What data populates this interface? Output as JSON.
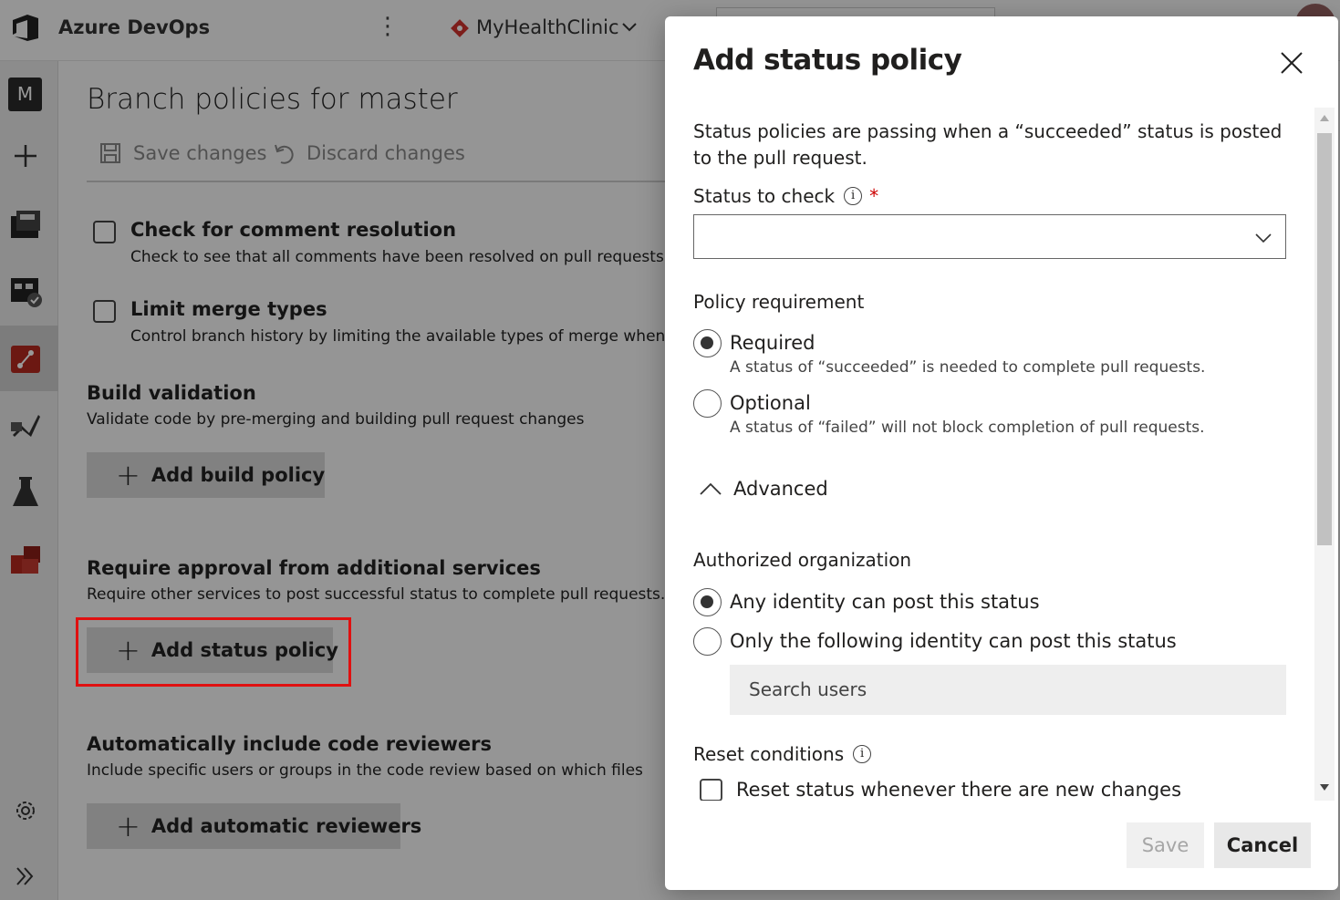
{
  "topbar": {
    "brand": "Azure DevOps",
    "project": "MyHealthClinic"
  },
  "leftnav": {
    "project_initial": "M"
  },
  "page": {
    "title": "Branch policies for master",
    "toolbar": {
      "save_label": "Save changes",
      "discard_label": "Discard changes"
    },
    "checks": [
      {
        "title": "Check for comment resolution",
        "desc": "Check to see that all comments have been resolved on pull requests."
      },
      {
        "title": "Limit merge types",
        "desc": "Control branch history by limiting the available types of merge when"
      }
    ],
    "build": {
      "title": "Build validation",
      "desc": "Validate code by pre-merging and building pull request changes",
      "button": "Add build policy"
    },
    "approval": {
      "title": "Require approval from additional services",
      "desc": "Require other services to post successful status to complete pull requests.",
      "button": "Add status policy"
    },
    "reviewers": {
      "title": "Automatically include code reviewers",
      "desc": "Include specific users or groups in the code review based on which files",
      "button": "Add automatic reviewers"
    }
  },
  "dialog": {
    "title": "Add status policy",
    "intro": "Status policies are passing when a “succeeded” status is posted to the pull request.",
    "status_label": "Status to check",
    "required_marker": "*",
    "status_value": "",
    "policy_requirement_label": "Policy requirement",
    "options": [
      {
        "label": "Required",
        "desc": "A status of “succeeded” is needed to complete pull requests.",
        "selected": true
      },
      {
        "label": "Optional",
        "desc": "A status of “failed” will not block completion of pull requests.",
        "selected": false
      }
    ],
    "advanced_label": "Advanced",
    "authorized_label": "Authorized organization",
    "auth_options": [
      {
        "label": "Any identity can post this status",
        "selected": true
      },
      {
        "label": "Only the following identity can post this status",
        "selected": false
      }
    ],
    "search_placeholder": "Search users",
    "reset_label": "Reset conditions",
    "reset_checkbox": "Reset status whenever there are new changes",
    "save_button": "Save",
    "cancel_button": "Cancel"
  },
  "colors": {
    "highlight": "#e01010",
    "overlay": "rgba(0,0,0,0.40)",
    "required": "#cc0000"
  }
}
